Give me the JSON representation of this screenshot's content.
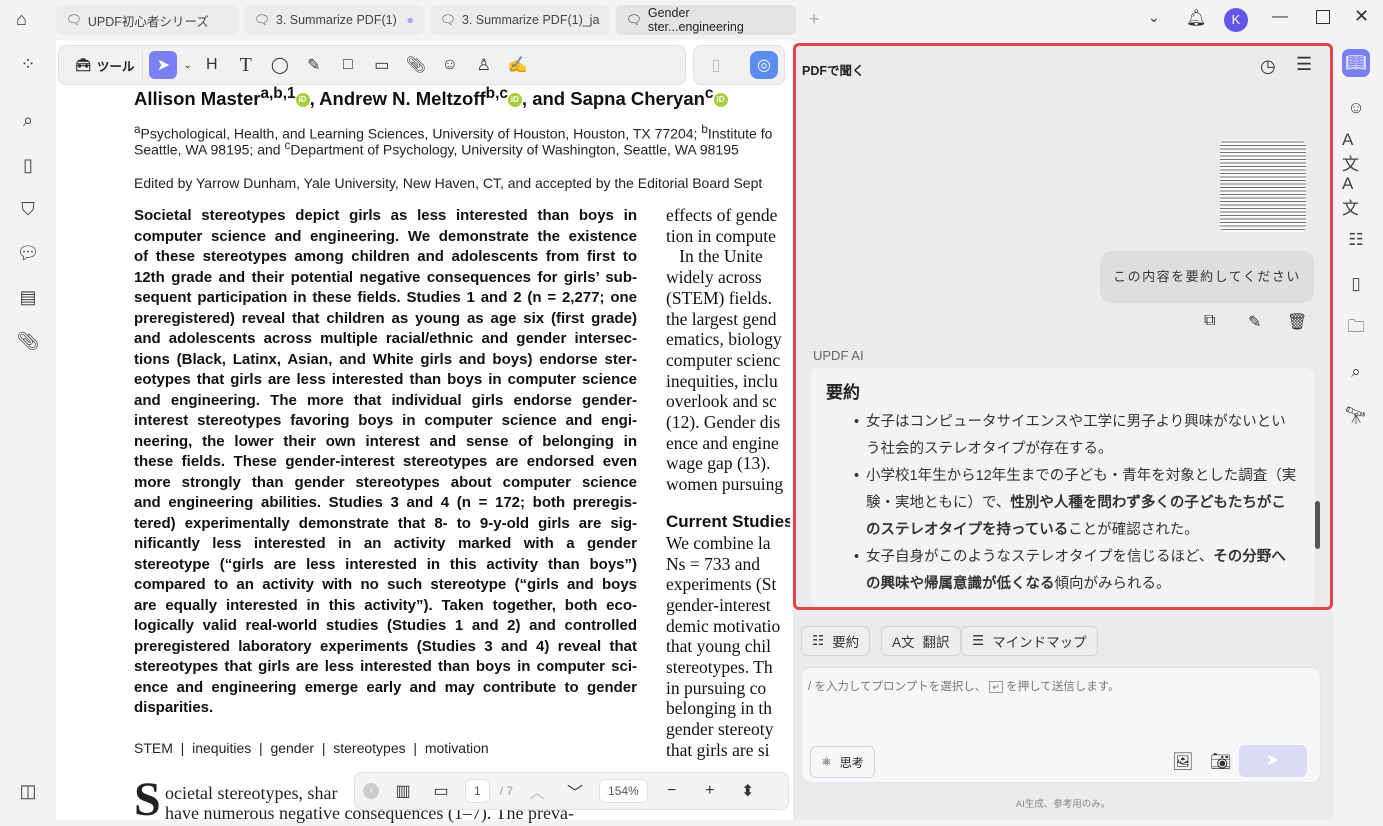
{
  "tabs": [
    {
      "label": "UPDF初心者シリーズ"
    },
    {
      "label": "3. Summarize PDF(1)"
    },
    {
      "label": "3. Summarize PDF(1)_ja"
    },
    {
      "label": "Gender ster...engineering"
    }
  ],
  "user_avatar": "K",
  "toolbar": {
    "tools_label": "ツール"
  },
  "doc": {
    "authors": [
      {
        "name": "Allison Master",
        "sup": "a,b,1"
      },
      {
        "name": ", Andrew N. Meltzoff",
        "sup": "b,c"
      },
      {
        "name": ", and Sapna Cheryan",
        "sup": "c"
      }
    ],
    "aff1_sup": "a",
    "aff1": "Psychological, Health, and Learning Sciences, University of Houston, Houston, TX 77204; ",
    "aff1b_sup": "b",
    "aff1b": "Institute fo",
    "aff2": "Seattle, WA 98195; and ",
    "aff2_sup": "c",
    "aff2b": "Department of Psychology, University of Washington, Seattle, WA 98195",
    "edited": "Edited by Yarrow Dunham, Yale University, New Haven, CT, and accepted by the Editorial Board Sept",
    "abstract_lines": [
      "Societal stereotypes depict girls as less interested than boys in",
      "computer science and engineering. We demonstrate the existence",
      "of these stereotypes among children and adolescents from first to",
      "12th grade and their potential negative consequences for girls’ sub-",
      "sequent participation in these fields. Studies 1 and 2 (n = 2,277; one",
      "preregistered) reveal that children as young as age six (first grade)",
      "and adolescents across multiple racial/ethnic and gender intersec-",
      "tions (Black, Latinx, Asian, and White girls and boys) endorse ster-",
      "eotypes that girls are less interested than boys in computer science",
      "and engineering. The more that individual girls endorse gender-",
      "interest stereotypes favoring boys in computer science and engi-",
      "neering, the lower their own interest and sense of belonging in",
      "these fields. These gender-interest stereotypes are endorsed even",
      "more strongly than gender stereotypes about computer science",
      "and engineering abilities. Studies 3 and 4 (n = 172; both preregis-",
      "tered) experimentally demonstrate that 8- to 9-y-old girls are sig-",
      "nificantly less interested in an activity marked with a gender",
      "stereotype (“girls are less interested in this activity than boys”)",
      "compared to an activity with no such stereotype (“girls and boys",
      "are equally interested in this activity”). Taken together, both eco-",
      "logically valid real-world studies (Studies 1 and 2) and controlled",
      "preregistered laboratory experiments (Studies 3 and 4) reveal that",
      "stereotypes that girls are less interested than boys in computer sci-",
      "ence and engineering emerge early and may contribute to gender",
      "disparities."
    ],
    "right_lines": [
      "effects of gende",
      "tion in compute",
      "   In the Unite",
      "widely across ",
      "(STEM) fields.",
      "the largest gend",
      "ematics, biology",
      "computer scienc",
      "inequities, inclu",
      "overlook and sc",
      "(12). Gender dis",
      "ence and engine",
      "wage gap (13).",
      "women pursuing"
    ],
    "current_studies": "Current Studies",
    "right_lines2": [
      "We combine la",
      "Ns = 733 and ",
      "experiments (St",
      "gender-interest ",
      "demic motivatio",
      "that young chil",
      "stereotypes. Th",
      "in pursuing co",
      "belonging in th",
      "gender stereoty",
      "that girls are si"
    ],
    "keywords": [
      "STEM",
      "inequities",
      "gender",
      "stereotypes",
      "motivation"
    ],
    "dropcap": "S",
    "body_lines": [
      "ocietal stereotypes, shar",
      "have numerous negative consequences (1–7). The preva-"
    ]
  },
  "pager": {
    "page": "1",
    "total": "/ 7",
    "zoom": "154%"
  },
  "ai": {
    "title": "PDFで聞く",
    "user_message": "この内容を要約してください",
    "ai_label": "UPDF AI",
    "summary_title": "要約",
    "bullets": [
      {
        "parts": [
          {
            "t": "女子はコンピュータサイエンスや工学に男子より興味がないという社会的ステレオタイプが存在する。",
            "b": false
          }
        ]
      },
      {
        "parts": [
          {
            "t": "小学校1年生から12年生までの子ども・青年を対象とした調査（実験・実地ともに）で、",
            "b": false
          },
          {
            "t": "性別や人種を問わず多くの子どもたちがこのステレオタイプを持っている",
            "b": true
          },
          {
            "t": "ことが確認された。",
            "b": false
          }
        ]
      },
      {
        "parts": [
          {
            "t": "女子自身がこのようなステレオタイプを信じるほど、",
            "b": false
          },
          {
            "t": "その分野への興味や帰属意識が低くなる",
            "b": true
          },
          {
            "t": "傾向がみられる。",
            "b": false
          }
        ]
      }
    ],
    "chips": [
      "要約",
      "翻訳",
      "マインドマップ"
    ],
    "placeholder_a": "/ を入力してプロンプトを選択し、",
    "placeholder_b": "を押して送信します。",
    "think": "思考",
    "disclaimer": "AI生成、参考用のみ。",
    "accent": "#7b7ff5",
    "highlight_border": "#e0454a"
  }
}
